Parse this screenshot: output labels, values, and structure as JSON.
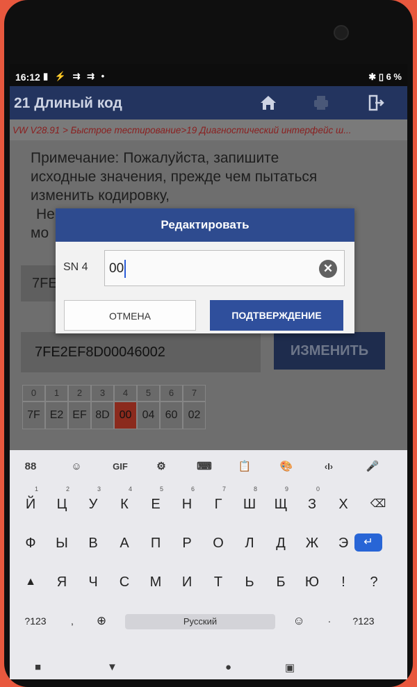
{
  "status_bar": {
    "time": "16:12",
    "left_icons": [
      "battery-icon",
      "usb-icon",
      "cast-icon",
      "cast-icon",
      "dot-icon"
    ],
    "battery": "6 %"
  },
  "app_bar": {
    "title": "21 Длиный код",
    "icons": [
      "home-icon",
      "print-icon",
      "exit-icon"
    ]
  },
  "breadcrumb": "VW V28.91 > Быстрое тестирование>19 Диагностический интерфейс ш...",
  "note": {
    "line1": "Примечание: Пожалуйста, запишите",
    "line2": "исходные значения, прежде чем пытаться",
    "line3": "изменить кодировку,",
    "line4": "Не",
    "line5": "мо"
  },
  "coding": {
    "current_code_partial": "7FE",
    "code": "7FE2EF8D00046002",
    "change_button": "ИЗМЕНИТЬ"
  },
  "byte_grid": {
    "indices": [
      "0",
      "1",
      "2",
      "3",
      "4",
      "5",
      "6",
      "7"
    ],
    "values": [
      "7F",
      "E2",
      "EF",
      "8D",
      "00",
      "04",
      "60",
      "02"
    ],
    "selected_index": 4
  },
  "dialog": {
    "title": "Редактировать",
    "field_label": "SN 4",
    "field_value": "00",
    "cancel": "ОТМЕНА",
    "confirm": "ПОДТВЕРЖДЕНИЕ"
  },
  "keyboard": {
    "toolbar": [
      "88",
      "☺",
      "GIF",
      "⚙",
      "⌨",
      "📋",
      "🎨",
      "‹I›",
      "🎤"
    ],
    "row1": [
      "Й",
      "Ц",
      "У",
      "К",
      "Е",
      "Н",
      "Г",
      "Ш",
      "Щ",
      "З",
      "Х"
    ],
    "row1_hints": [
      "1",
      "2",
      "3",
      "4",
      "5",
      "6",
      "7",
      "8",
      "9",
      "0"
    ],
    "row2": [
      "Ф",
      "Ы",
      "В",
      "А",
      "П",
      "Р",
      "О",
      "Л",
      "Д",
      "Ж",
      "Э"
    ],
    "row3": [
      "Я",
      "Ч",
      "С",
      "М",
      "И",
      "Т",
      "Ь",
      "Б",
      "Ю",
      "!",
      "?"
    ],
    "row4_left": "?123",
    "space_label": "Русский",
    "row4_right": "?123"
  }
}
